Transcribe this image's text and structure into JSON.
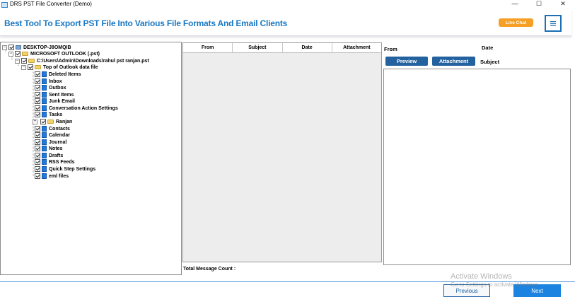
{
  "window": {
    "title": "DRS PST File Converter (Demo)",
    "minimize": "—",
    "maximize": "☐",
    "close": "✕"
  },
  "header": {
    "title": "Best Tool To Export PST File Into Various File Formats And Email Clients",
    "live_chat": "Live Chat",
    "menu_icon": "hamburger-icon"
  },
  "tree": {
    "root": "DESKTOP-J8OMQIB",
    "store": "MICROSOFT OUTLOOK (.pst)",
    "file": "C:\\Users\\Admin\\Downloads\\rahul pst ranjan.pst",
    "top": "Top of Outlook data file",
    "folders": [
      "Deleted Items",
      "Inbox",
      "Outbox",
      "Sent Items",
      "Junk Email",
      "Conversation Action Settings",
      "Tasks",
      "Ranjan",
      "Contacts",
      "Calendar",
      "Journal",
      "Notes",
      "Drafts",
      "RSS Feeds",
      "Quick Step Settings",
      "eml files"
    ]
  },
  "message_list": {
    "columns": [
      "From",
      "Subject",
      "Date",
      "Attachment"
    ],
    "total_label": "Total Message Count :"
  },
  "preview": {
    "from_label": "From",
    "date_label": "Date",
    "subject_label": "Subject",
    "preview_button": "Preview",
    "attachment_button": "Attachment"
  },
  "footer": {
    "previous": "Previous",
    "next": "Next"
  },
  "watermark": {
    "line1": "Activate Windows",
    "line2": "Go to Settings to activate Windows."
  },
  "colors": {
    "accent": "#1a78c2",
    "button_blue": "#23619f",
    "live_chat": "#f5a025",
    "next_button": "#1d83e0"
  }
}
